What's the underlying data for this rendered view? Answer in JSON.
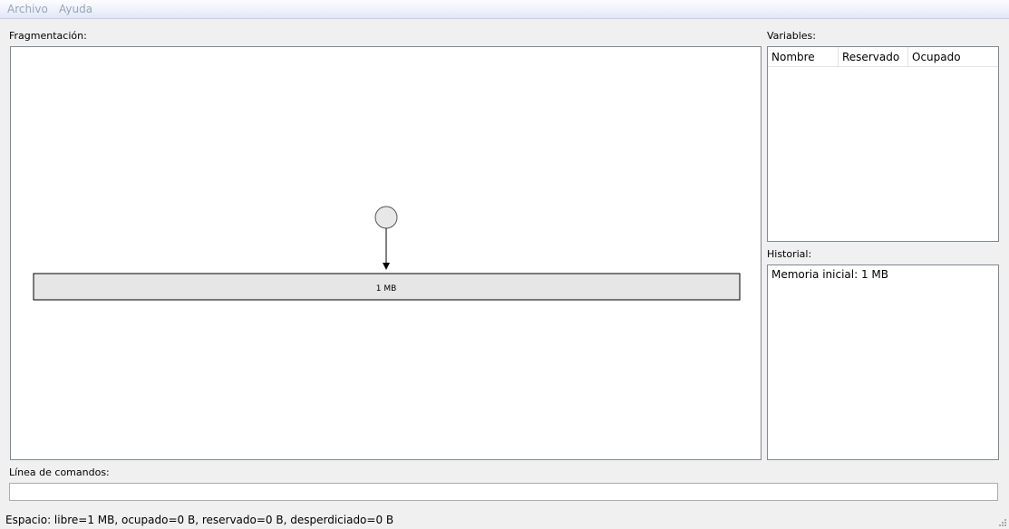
{
  "menu": {
    "archivo": "Archivo",
    "ayuda": "Ayuda"
  },
  "fragmentation": {
    "label": "Fragmentación:",
    "block_label": "1 MB"
  },
  "variables": {
    "label": "Variables:",
    "columns": [
      "Nombre",
      "Reservado",
      "Ocupado"
    ]
  },
  "history": {
    "label": "Historial:",
    "items": [
      "Memoria inicial: 1 MB"
    ]
  },
  "command_line": {
    "label": "Línea de comandos:",
    "value": ""
  },
  "status": "Espacio: libre=1 MB, ocupado=0 B, reservado=0 B, desperdiciado=0 B",
  "colors": {
    "block_fill": "#e6e6e6",
    "pointer_fill": "#e8e8e8",
    "border": "#828790"
  }
}
